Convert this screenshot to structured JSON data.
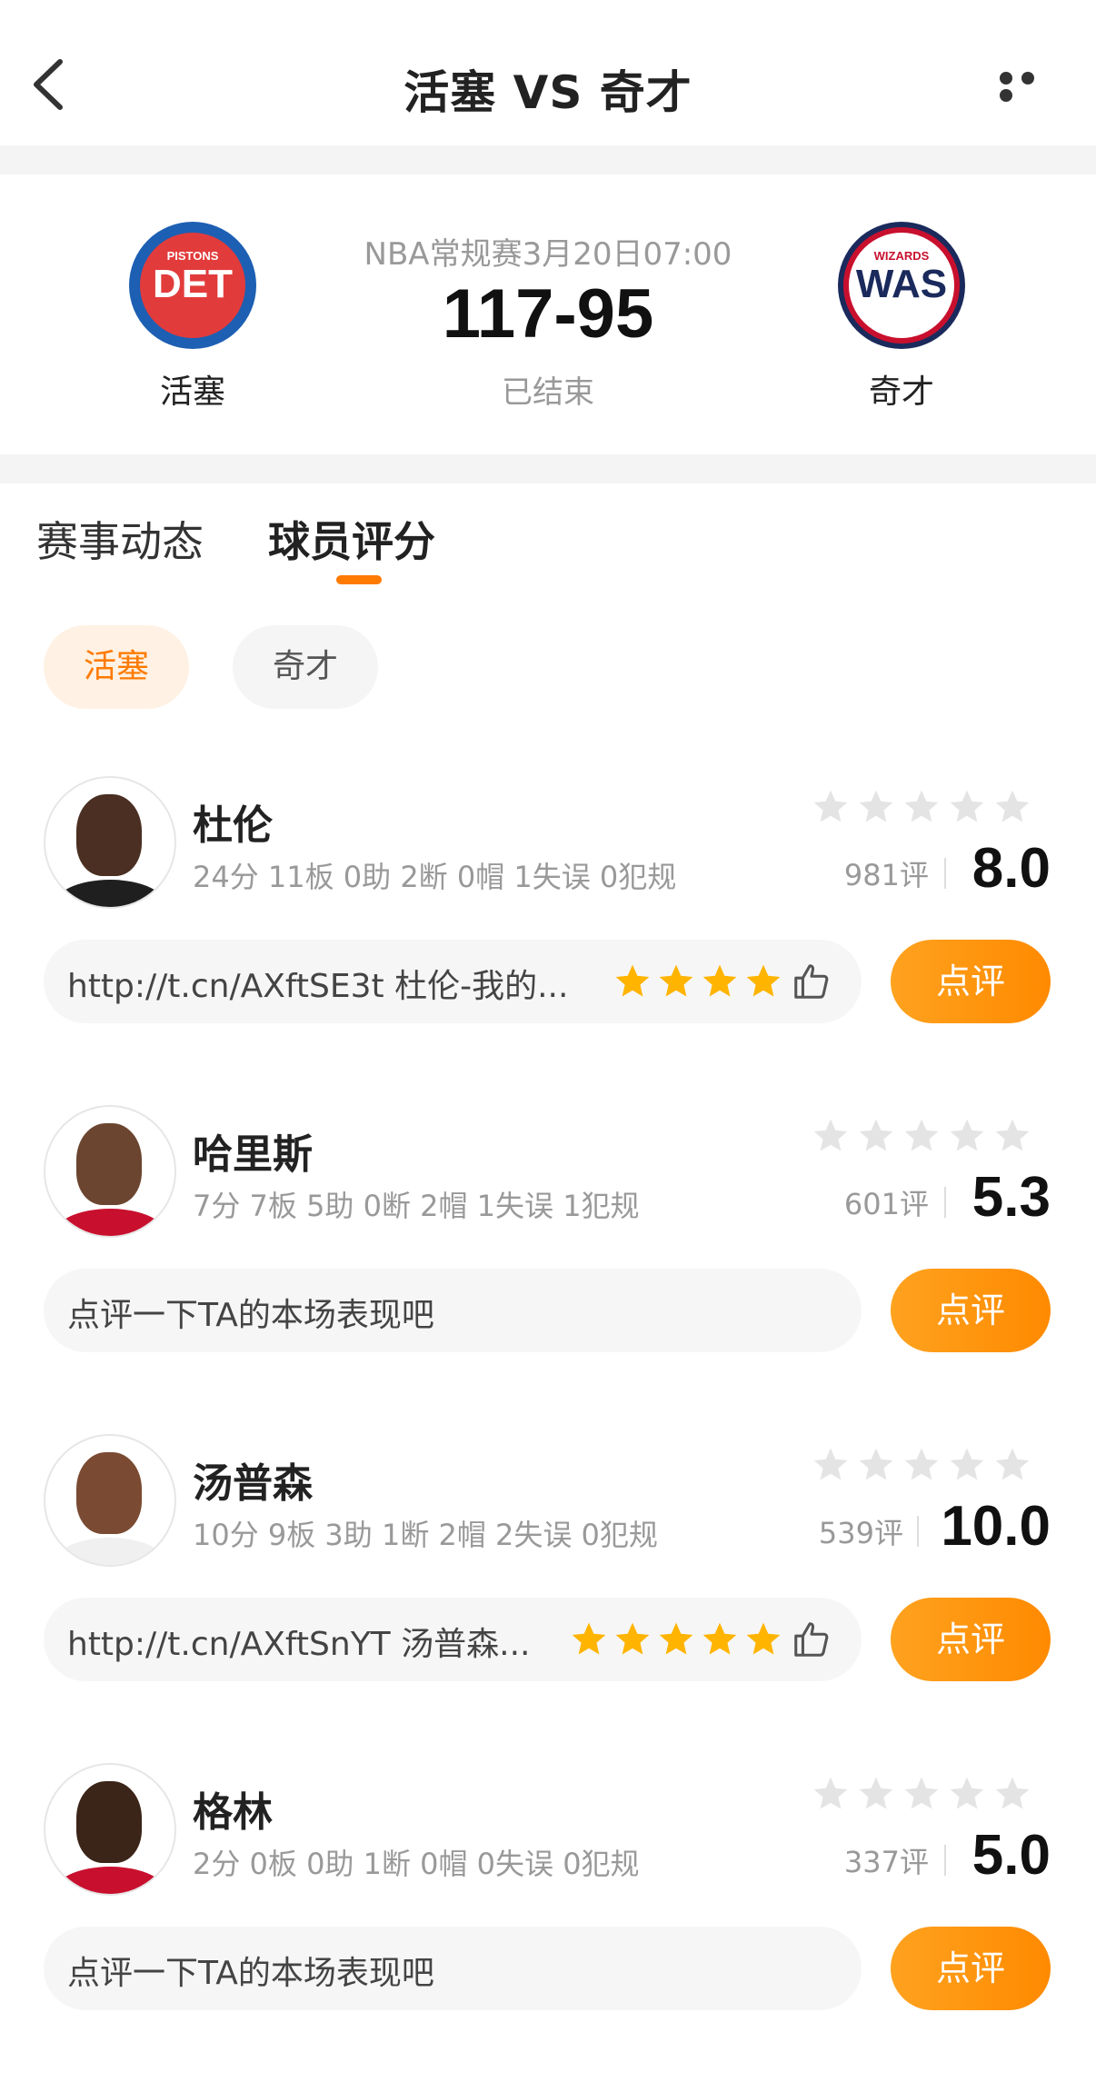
{
  "nav": {
    "title": "活塞 VS 奇才"
  },
  "match": {
    "info": "NBA常规赛3月20日07:00",
    "score": "117-95",
    "status": "已结束",
    "home": {
      "name": "活塞",
      "abbr": "DET",
      "sub": "PISTONS",
      "color": "#1d5fb3"
    },
    "away": {
      "name": "奇才",
      "abbr": "WAS",
      "sub": "WIZARDS",
      "color": "#1b2a5c"
    }
  },
  "tabs": [
    {
      "label": "赛事动态"
    },
    {
      "label": "球员评分"
    }
  ],
  "filters": [
    {
      "label": "活塞"
    },
    {
      "label": "奇才"
    }
  ],
  "players": [
    {
      "name": "杜伦",
      "stats": "24分 11板 0助 2断 0帽 1失误 0犯规",
      "rating_count": "981评",
      "score": "8.0",
      "comment": "http://t.cn/AXftSE3t 杜伦-我的...",
      "comment_stars": 4,
      "button": "点评"
    },
    {
      "name": "哈里斯",
      "stats": "7分 7板 5助 0断 2帽 1失误 1犯规",
      "rating_count": "601评",
      "score": "5.3",
      "comment": "点评一下TA的本场表现吧",
      "comment_stars": 0,
      "button": "点评"
    },
    {
      "name": "汤普森",
      "stats": "10分 9板 3助 1断 2帽 2失误 0犯规",
      "rating_count": "539评",
      "score": "10.0",
      "comment": "http://t.cn/AXftSnYT 汤普森...",
      "comment_stars": 5,
      "button": "点评"
    },
    {
      "name": "格林",
      "stats": "2分 0板 0助 1断 0帽 0失误 0犯规",
      "rating_count": "337评",
      "score": "5.0",
      "comment": "点评一下TA的本场表现吧",
      "comment_stars": 0,
      "button": "点评"
    }
  ],
  "colors": {
    "accent": "#ff8a00",
    "star_filled": "#ffb400",
    "star_empty": "#e4e4e4"
  }
}
